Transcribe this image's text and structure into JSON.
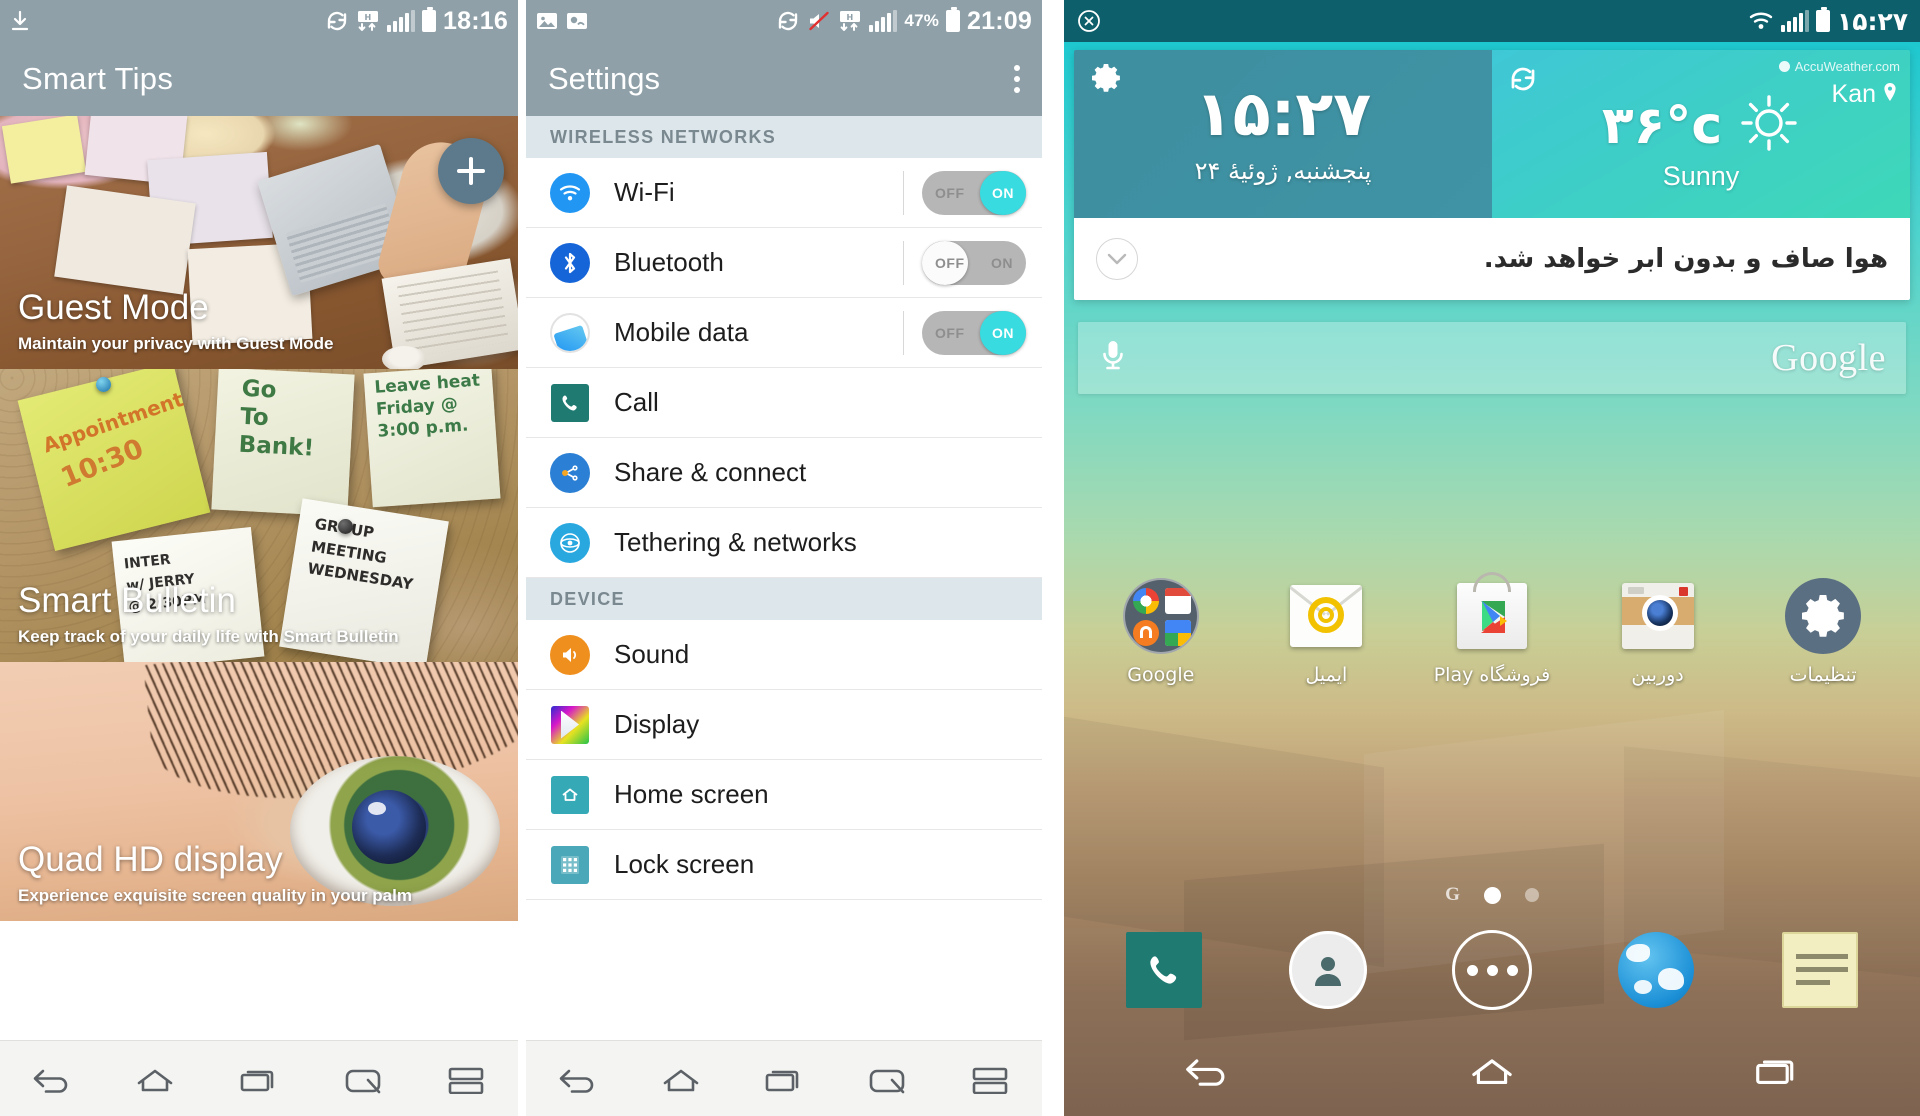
{
  "panels": {
    "smart_tips": {
      "statusbar": {
        "time": "18:16",
        "left_icons": [
          "download-icon"
        ],
        "right_icons": [
          "sync-icon",
          "hd-data-icon",
          "signal-icon",
          "battery-icon"
        ]
      },
      "appbar": {
        "title": "Smart Tips",
        "fab": "add-icon"
      },
      "tips": [
        {
          "title": "Guest Mode",
          "subtitle": "Maintain your privacy with Guest Mode"
        },
        {
          "title": "Smart Bulletin",
          "subtitle": "Keep track of your daily life with Smart Bulletin"
        },
        {
          "title": "Quad HD display",
          "subtitle": "Experience exquisite screen quality in your palm"
        }
      ],
      "notes": [
        {
          "line1": "Appointment",
          "line2": "10:30"
        },
        {
          "line1": "Go",
          "line2": "To",
          "line3": "Bank!"
        },
        {
          "line1": "Leave heat",
          "line2": "Friday @",
          "line3": "3:00 p.m."
        },
        {
          "line1": "GROUP",
          "line2": "MEETING",
          "line3": "WEDNESDAY"
        },
        {
          "line1": "INTER",
          "line2": "w/ JERRY",
          "line3": "@ 2:30PM"
        }
      ],
      "navbar": [
        "back-icon",
        "home-icon",
        "recents-icon",
        "qslide-icon",
        "dual-window-icon"
      ]
    },
    "settings": {
      "statusbar": {
        "time": "21:09",
        "battery_percent": "47%",
        "left_icons": [
          "screenshot-icon",
          "app-icon"
        ],
        "right_icons": [
          "sync-icon",
          "mute-icon",
          "hd-data-icon",
          "signal-icon",
          "battery-icon"
        ]
      },
      "appbar": {
        "title": "Settings",
        "overflow": "more-options-icon"
      },
      "sections": [
        {
          "header": "WIRELESS NETWORKS",
          "items": [
            {
              "label": "Wi-Fi",
              "icon": "wifi-icon",
              "toggle": "on",
              "off_label": "OFF",
              "on_label": "ON"
            },
            {
              "label": "Bluetooth",
              "icon": "bluetooth-icon",
              "toggle": "off",
              "off_label": "OFF",
              "on_label": "ON"
            },
            {
              "label": "Mobile data",
              "icon": "mobiledata-icon",
              "toggle": "on",
              "off_label": "OFF",
              "on_label": "ON"
            },
            {
              "label": "Call",
              "icon": "call-icon",
              "toggle": null
            },
            {
              "label": "Share & connect",
              "icon": "share-icon",
              "toggle": null
            },
            {
              "label": "Tethering & networks",
              "icon": "tethering-icon",
              "toggle": null
            }
          ]
        },
        {
          "header": "DEVICE",
          "items": [
            {
              "label": "Sound",
              "icon": "sound-icon",
              "toggle": null
            },
            {
              "label": "Display",
              "icon": "display-icon",
              "toggle": null
            },
            {
              "label": "Home screen",
              "icon": "homescreen-icon",
              "toggle": null
            },
            {
              "label": "Lock screen",
              "icon": "lockscreen-icon",
              "toggle": null
            }
          ]
        }
      ],
      "navbar": [
        "back-icon",
        "home-icon",
        "recents-icon",
        "qslide-icon",
        "dual-window-icon"
      ]
    },
    "home": {
      "statusbar": {
        "time": "۱۵:۲۷",
        "left_icons": [
          "cancel-icon"
        ],
        "right_icons": [
          "wifi-icon",
          "signal-icon",
          "battery-icon"
        ]
      },
      "widget": {
        "clock": {
          "time": "۱۵:۲۷",
          "date": "پنجشنبه, ژوئیهٔ ۲۴",
          "settings_icon": "gear-icon"
        },
        "weather": {
          "refresh_icon": "sync-icon",
          "provider": "AccuWeather.com",
          "location": "Kan",
          "location_icon": "pin-icon",
          "temperature": "۳۶°c",
          "condition": "Sunny",
          "condition_icon": "sun-icon"
        },
        "forecast": {
          "text": "هوا صاف و بدون ابر خواهد شد.",
          "expand_icon": "chevron-down-icon"
        }
      },
      "search": {
        "mic_icon": "microphone-icon",
        "brand": "Google"
      },
      "apps": [
        {
          "label": "Google",
          "icon": "google-folder-icon"
        },
        {
          "label": "ایمیل",
          "icon": "email-icon"
        },
        {
          "label": "فروشگاه Play",
          "icon": "play-store-icon"
        },
        {
          "label": "دوربین",
          "icon": "camera-icon"
        },
        {
          "label": "تنظیمات",
          "icon": "settings-gear-icon"
        }
      ],
      "pager": {
        "glyph": "G",
        "dots": 2,
        "active": 0
      },
      "dock": [
        "phone-icon",
        "contacts-icon",
        "app-drawer-icon",
        "browser-icon",
        "messages-icon"
      ],
      "navbar": [
        "back-icon",
        "home-icon",
        "recents-icon"
      ]
    }
  },
  "colors": {
    "statusbar_grey": "#8fa0a8",
    "toggle_on": "#37dbe0",
    "section_header_bg": "#dde6ea",
    "home_teal": "#0c5f6b"
  }
}
